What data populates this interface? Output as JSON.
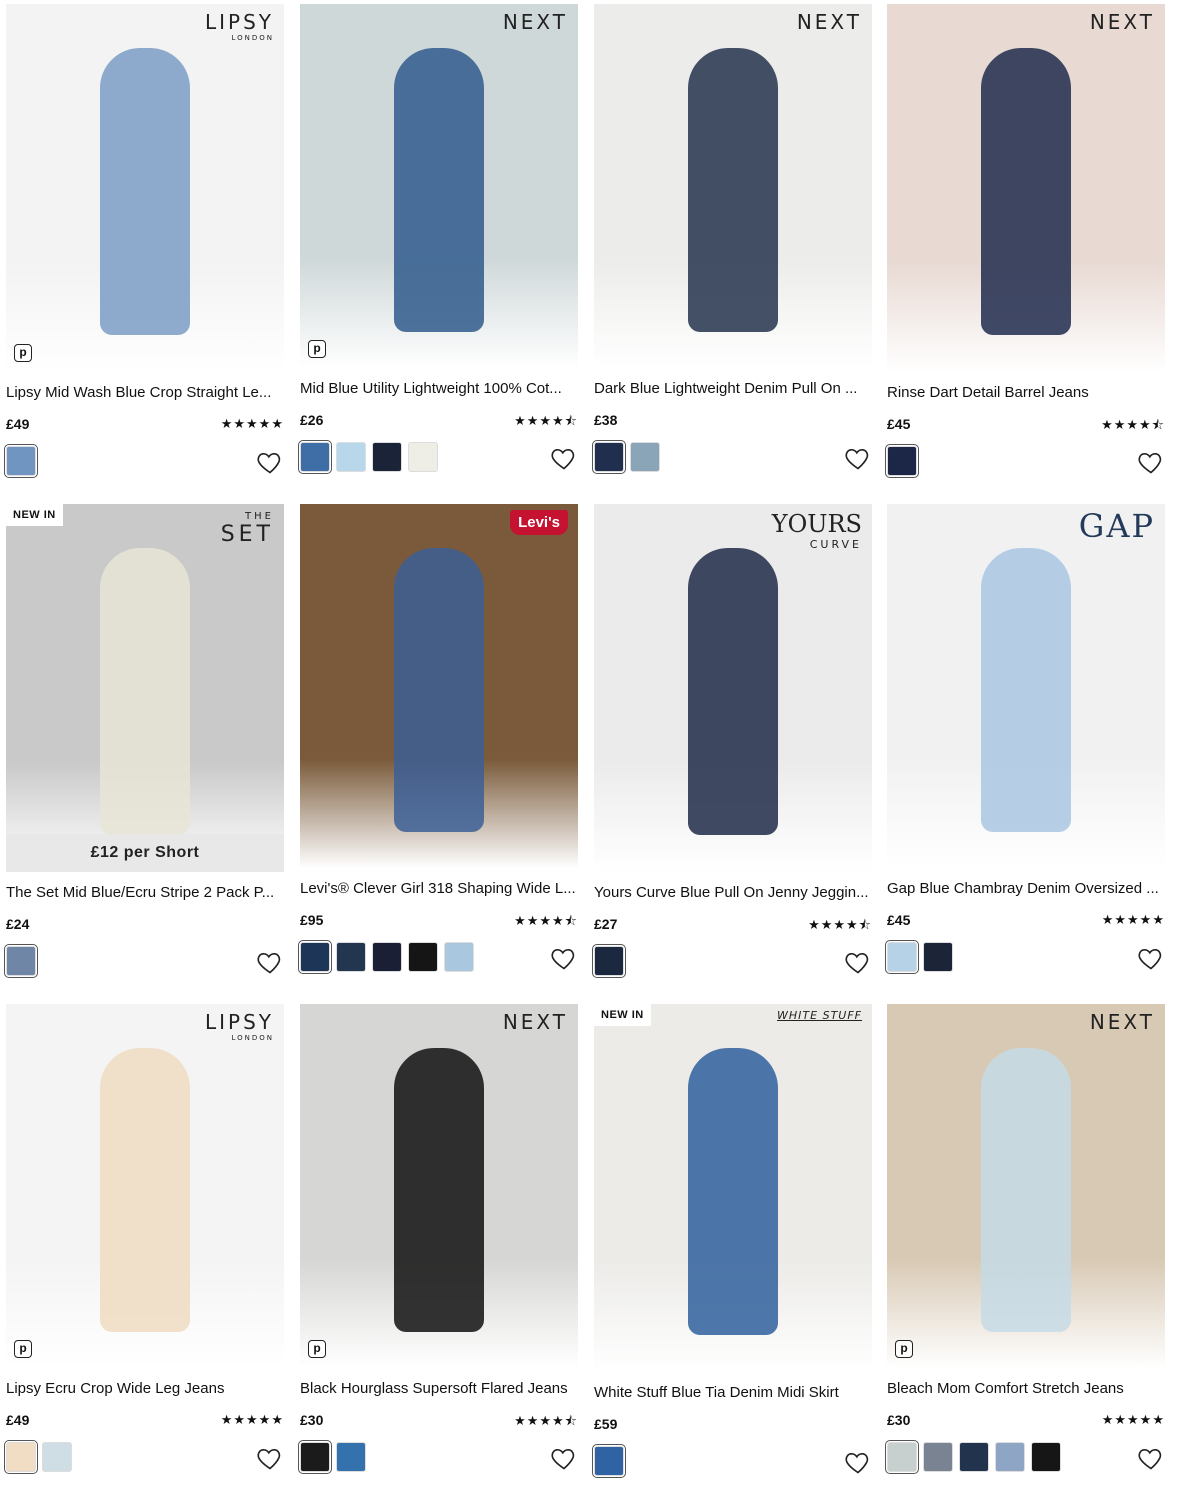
{
  "products": [
    {
      "brand": "LIPSY",
      "brand_sub": "LONDON",
      "title": "Lipsy Mid Wash Blue Crop Straight Le...",
      "price": "£49",
      "stars": "★★★★★",
      "swatches": [
        "#6f95c0"
      ],
      "p_icon": "p",
      "bg": "#f3f3f3",
      "figure": "#7a9cc4"
    },
    {
      "brand": "NEXT",
      "title": "Mid Blue Utility Lightweight 100% Cot...",
      "price": "£26",
      "stars": "★★★★⯪",
      "swatches": [
        "#3f6ea6",
        "#b9d7ea",
        "#1a2337",
        "#efeee6"
      ],
      "p_icon": "p",
      "bg": "#cfd8d9",
      "figure": "#2f5a8c"
    },
    {
      "brand": "NEXT",
      "title": "Dark Blue Lightweight Denim Pull On ...",
      "price": "£38",
      "stars": "",
      "swatches": [
        "#1f2f4d",
        "#8aa4b8"
      ],
      "p_icon": "",
      "bg": "#ececea",
      "figure": "#24324c"
    },
    {
      "brand": "NEXT",
      "title": "Rinse Dart Detail Barrel Jeans",
      "price": "£45",
      "stars": "★★★★⯪",
      "swatches": [
        "#1c2747"
      ],
      "p_icon": "",
      "bg": "#e8d9d3",
      "figure": "#1f2a4c"
    },
    {
      "brand": "SET",
      "brand_pre": "THE",
      "title": "The Set Mid Blue/Ecru Stripe 2 Pack P...",
      "price": "£24",
      "stars": "",
      "swatches": [
        "#6f86a6"
      ],
      "p_icon": "",
      "bg": "#c9c9c9",
      "figure": "#e8e5d6",
      "badge": "NEW IN",
      "promo": "£12 per Short"
    },
    {
      "brand": "Levi's",
      "title": "Levi's® Clever Girl 318 Shaping Wide L...",
      "price": "£95",
      "stars": "★★★★⯪",
      "swatches": [
        "#1d3557",
        "#233650",
        "#1b1f36",
        "#151515",
        "#a9c7de"
      ],
      "p_icon": "",
      "bg": "#7a5a3a",
      "figure": "#3c5f97"
    },
    {
      "brand": "YOURS",
      "brand_sub": "CURVE",
      "title": "Yours Curve Blue Pull On Jenny Jeggin...",
      "price": "£27",
      "stars": "★★★★⯪",
      "swatches": [
        "#1c2840"
      ],
      "p_icon": "",
      "bg": "#ebebeb",
      "figure": "#1e2a46"
    },
    {
      "brand": "GAP",
      "title": "Gap Blue Chambray Denim Oversized ...",
      "price": "£45",
      "stars": "★★★★★",
      "swatches": [
        "#b6d2e6",
        "#1c2438"
      ],
      "p_icon": "",
      "bg": "#f1f1f1",
      "figure": "#a9c7e2"
    },
    {
      "brand": "LIPSY",
      "brand_sub": "LONDON",
      "title": "Lipsy Ecru Crop Wide Leg Jeans",
      "price": "£49",
      "stars": "★★★★★",
      "swatches": [
        "#f1dcc4",
        "#cfdde4"
      ],
      "p_icon": "p",
      "bg": "#f4f4f4",
      "figure": "#efdcc2"
    },
    {
      "brand": "NEXT",
      "title": "Black Hourglass Supersoft Flared Jeans",
      "price": "£30",
      "stars": "★★★★⯪",
      "swatches": [
        "#1b1b1b",
        "#3472ad"
      ],
      "p_icon": "p",
      "bg": "#d6d6d4",
      "figure": "#111111"
    },
    {
      "brand": "WHITE STUFF",
      "title": "White Stuff Blue Tia Denim Midi Skirt",
      "price": "£59",
      "stars": "",
      "swatches": [
        "#2f63a3"
      ],
      "p_icon": "",
      "bg": "#ecebe8",
      "figure": "#2f5f9c",
      "badge": "NEW IN"
    },
    {
      "brand": "NEXT",
      "title": "Bleach Mom Comfort Stretch Jeans",
      "price": "£30",
      "stars": "★★★★★",
      "swatches": [
        "#c7cfcf",
        "#7a8391",
        "#22334e",
        "#8ea5c6",
        "#161616"
      ],
      "p_icon": "p",
      "bg": "#d8c9b4",
      "figure": "#c6dbe6"
    }
  ],
  "icons": {
    "wishlist": "heart-icon"
  }
}
